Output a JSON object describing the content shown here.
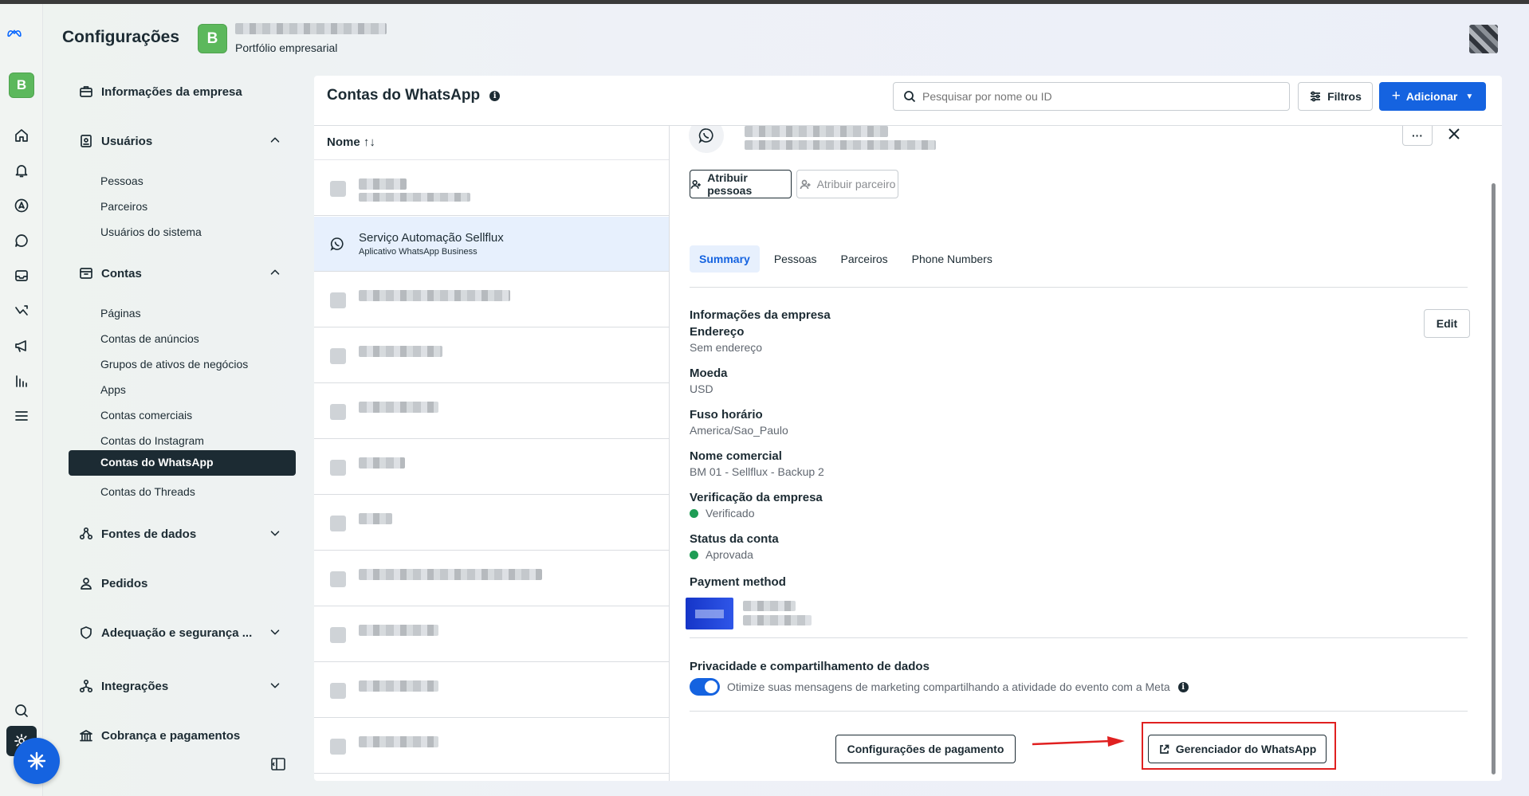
{
  "header": {
    "title": "Configurações",
    "portfolio_badge": "B",
    "portfolio_subtitle": "Portfólio empresarial"
  },
  "rail": {
    "business_badge": "B",
    "icons": [
      "home-icon",
      "bell-icon",
      "compass-icon",
      "chat-bubble-icon",
      "inbox-icon",
      "routing-icon",
      "megaphone-icon",
      "bar-chart-icon",
      "menu-icon"
    ],
    "bottom_icons": [
      "search-icon",
      "settings-icon"
    ]
  },
  "sidebar": {
    "empresa": "Informações da empresa",
    "usuarios": {
      "label": "Usuários",
      "items": [
        "Pessoas",
        "Parceiros",
        "Usuários do sistema"
      ]
    },
    "contas": {
      "label": "Contas",
      "items": [
        "Páginas",
        "Contas de anúncios",
        "Grupos de ativos de negócios",
        "Apps",
        "Contas comerciais",
        "Contas do Instagram",
        "Contas do WhatsApp",
        "Contas do Threads"
      ],
      "active": "Contas do WhatsApp"
    },
    "fontes": "Fontes de dados",
    "pedidos": "Pedidos",
    "adequacao": "Adequação e segurança ...",
    "integracoes": "Integrações",
    "cobranca": "Cobrança e pagamentos"
  },
  "panel": {
    "title": "Contas do WhatsApp",
    "search_placeholder": "Pesquisar por nome ou ID",
    "filter_label": "Filtros",
    "add_label": "Adicionar",
    "list_header": "Nome ↑↓",
    "selected_row": {
      "name": "Serviço Automação Sellflux",
      "type": "Aplicativo WhatsApp Business"
    }
  },
  "detail": {
    "assign_people": "Atribuir pessoas",
    "assign_partner": "Atribuir parceiro",
    "more_label": "···",
    "tabs": [
      "Summary",
      "Pessoas",
      "Parceiros",
      "Phone Numbers"
    ],
    "active_tab": "Summary",
    "company_info_title": "Informações da empresa",
    "edit_label": "Edit",
    "fields": [
      {
        "label": "Endereço",
        "value": "Sem endereço"
      },
      {
        "label": "Moeda",
        "value": "USD"
      },
      {
        "label": "Fuso horário",
        "value": "America/Sao_Paulo"
      },
      {
        "label": "Nome comercial",
        "value": "BM 01 - Sellflux - Backup 2"
      },
      {
        "label": "Verificação da empresa",
        "value": "Verificado"
      },
      {
        "label": "Status da conta",
        "value": "Aprovada"
      }
    ],
    "payment_method_label": "Payment method",
    "privacy_title": "Privacidade e compartilhamento de dados",
    "privacy_toggle_label": "Otimize suas mensagens de marketing compartilhando a atividade do evento com a Meta",
    "privacy_toggle_on": true,
    "btn_payment_settings": "Configurações de pagamento",
    "btn_whatsapp_manager": "Gerenciador do WhatsApp"
  },
  "colors": {
    "accent": "#1563e0",
    "dark": "#1c2b33",
    "status_green": "#1f9d55",
    "annotation_red": "#e02020"
  }
}
